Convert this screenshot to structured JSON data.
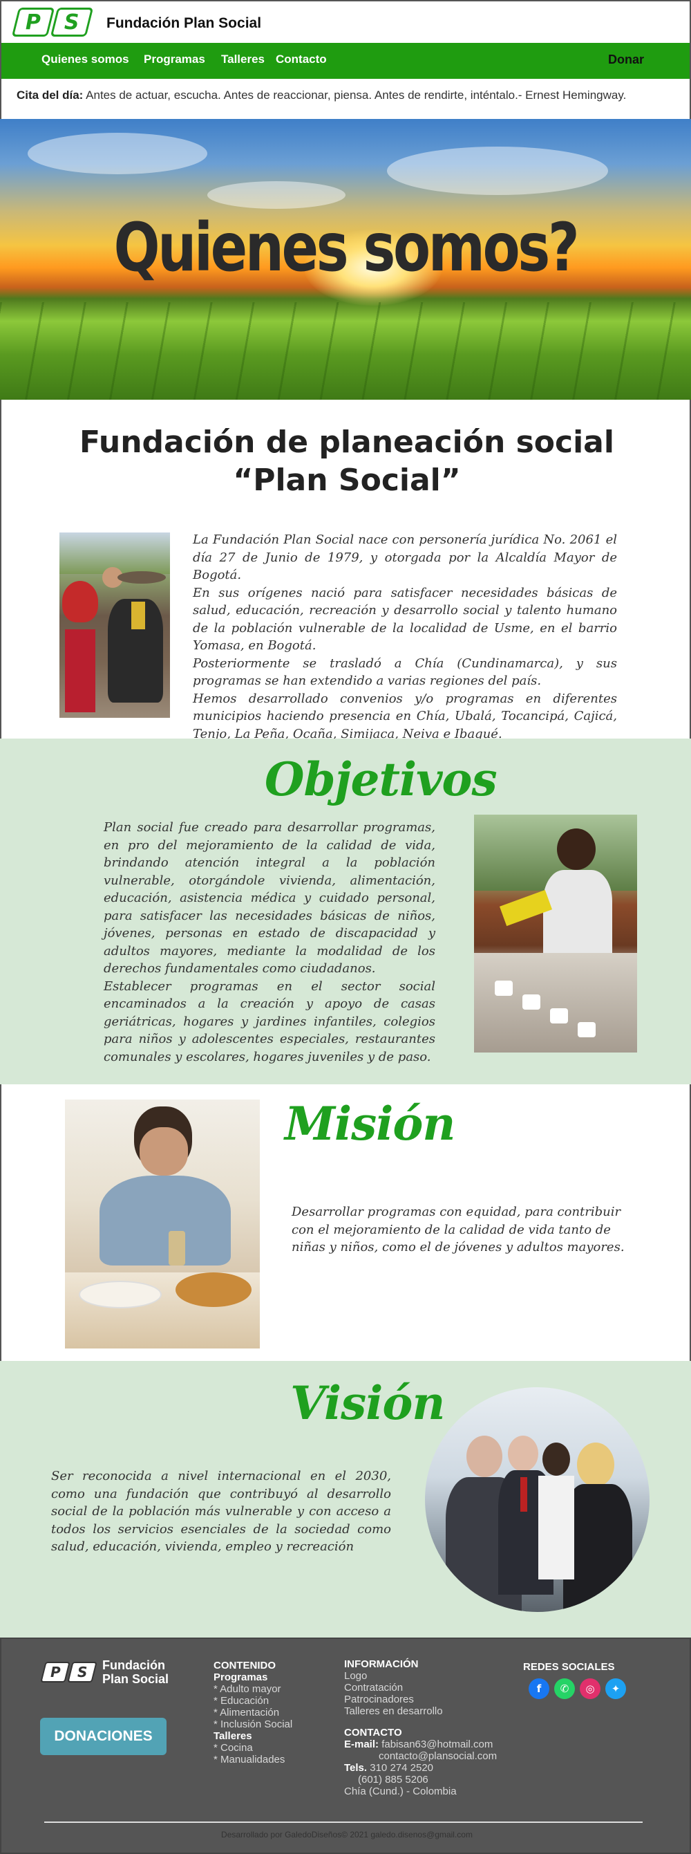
{
  "header": {
    "logo_letters": [
      "P",
      "S"
    ],
    "brand": "Fundación Plan Social",
    "nav": [
      "Quienes somos",
      "Programas",
      "Talleres",
      "Contacto"
    ],
    "donate": "Donar",
    "quote_label": "Cita del día:",
    "quote": "Antes de actuar, escucha. Antes de reaccionar, piensa. Antes de rendirte, inténtalo.- Ernest Hemingway."
  },
  "hero": {
    "title": "Quienes somos?"
  },
  "intro": {
    "heading_line1": "Fundación de planeación social",
    "heading_line2": "“Plan Social”",
    "paragraphs": [
      "La Fundación Plan Social nace con personería jurídica No. 2061 el día 27 de Junio de 1979, y otorgada por la Alcaldía Mayor de Bogotá.",
      "En sus orígenes nació para satisfacer necesidades básicas de salud, educación, recreación y desarrollo social y talento humano de la población vulnerable de la localidad de Usme, en el barrio Yomasa, en Bogotá.",
      "Posteriormente se trasladó a Chía (Cundinamarca), y sus programas se han extendido a varias regiones del país.",
      "Hemos desarrollado convenios y/o programas en diferentes municipios haciendo presencia en Chía, Ubalá, Tocancipá, Cajicá, Tenjo, La Peña, Ocaña, Simijaca, Neiva e Ibagué."
    ]
  },
  "objetivos": {
    "heading": "Objetivos",
    "paragraphs": [
      "Plan social fue creado para desarrollar programas, en pro del mejoramiento de la calidad de vida, brindando atención integral a la población vulnerable, otorgándole vivienda, alimentación, educación, asistencia médica y cuidado personal, para satisfacer las necesidades básicas de niños, jóvenes, personas en estado de discapacidad y adultos mayores, mediante la modalidad de los derechos fundamentales como ciudadanos.",
      "Establecer programas en el sector social encaminados a la creación y apoyo de casas geriátricas, hogares y jardines infantiles, colegios para niños y adolescentes especiales, restaurantes comunales y escolares, hogares juveniles y de paso."
    ]
  },
  "mision": {
    "heading": "Misión",
    "text": "Desarrollar programas con equidad, para contribuir con el mejoramiento de la calidad de vida tanto de niñas y niños, como el de jóvenes y adultos mayores."
  },
  "vision": {
    "heading": "Visión",
    "text": "Ser reconocida a nivel internacional en el 2030, como una fundación que contribuyó al desarrollo social de la población más vulnerable y con acceso a todos los servicios esenciales de la sociedad como salud, educación, vivienda, empleo y recreación"
  },
  "footer": {
    "brand_line1": "Fundación",
    "brand_line2": "Plan Social",
    "donate_button": "DONACIONES",
    "contenido": {
      "title": "CONTENIDO",
      "programas_title": "Programas",
      "programas": [
        "* Adulto mayor",
        "* Educación",
        "* Alimentación",
        "* Inclusión Social"
      ],
      "talleres_title": "Talleres",
      "talleres": [
        "* Cocina",
        "* Manualidades"
      ]
    },
    "informacion": {
      "title": "INFORMACIÓN",
      "links": [
        "Logo",
        "Contratación",
        "Patrocinadores",
        "Talleres en desarrollo"
      ]
    },
    "contacto": {
      "title": "CONTACTO",
      "email_label": "E-mail:",
      "email1": "fabisan63@hotmail.com",
      "email2": "contacto@plansocial.com",
      "tel_label": "Tels.",
      "tel1": "310 274 2520",
      "tel2": "(601) 885 5206",
      "city": "Chía (Cund.) - Colombia"
    },
    "redes": {
      "title": "REDES SOCIALES",
      "icons": [
        "facebook-icon",
        "whatsapp-icon",
        "instagram-icon",
        "twitter-icon"
      ],
      "colors": [
        "#1877f2",
        "#25d366",
        "#e1306c",
        "#1da1f2"
      ]
    },
    "credit": "Desarrollado por GaledoDiseños© 2021 galedo.disenos@gmail.com"
  },
  "colors": {
    "brand_green": "#1f9c10",
    "section_green": "#d6e8d6",
    "footer_gray": "#555555",
    "donate_teal": "#52a3b5"
  }
}
